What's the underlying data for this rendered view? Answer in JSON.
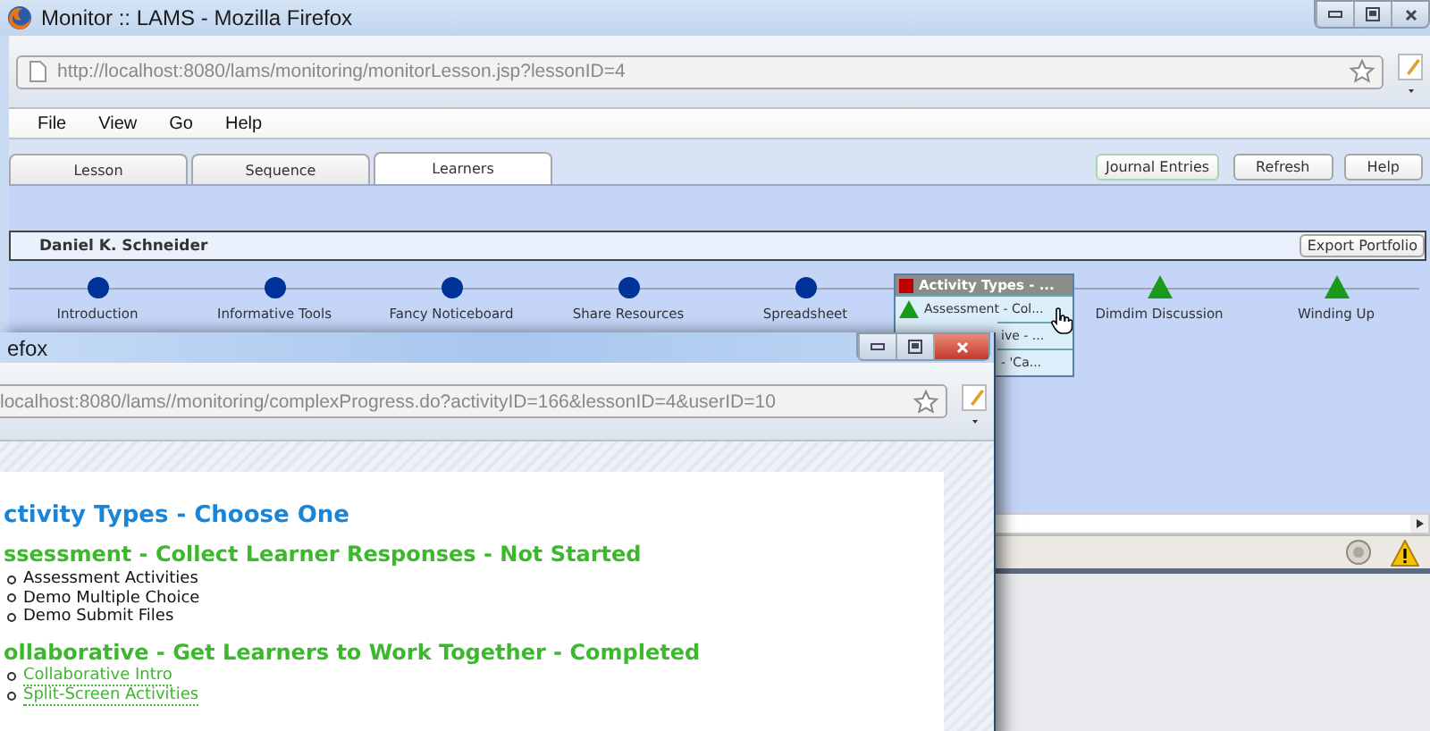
{
  "main_window": {
    "title": "Monitor :: LAMS - Mozilla Firefox",
    "url": "http://localhost:8080/lams/monitoring/monitorLesson.jsp?lessonID=4",
    "menu": [
      "File",
      "View",
      "Go",
      "Help"
    ],
    "tabs": [
      {
        "label": "Lesson",
        "selected": false
      },
      {
        "label": "Sequence",
        "selected": false
      },
      {
        "label": "Learners",
        "selected": true
      }
    ],
    "buttons": [
      "Journal Entries",
      "Refresh",
      "Help"
    ],
    "learner": {
      "name": "Daniel K. Schneider",
      "export_button": "Export Portfolio"
    },
    "activities": [
      {
        "label": "Introduction",
        "kind": "circle"
      },
      {
        "label": "Informative Tools",
        "kind": "circle"
      },
      {
        "label": "Fancy Noticeboard",
        "kind": "circle"
      },
      {
        "label": "Share Resources",
        "kind": "circle"
      },
      {
        "label": "Spreadsheet",
        "kind": "circle"
      },
      {
        "kind": "popup"
      },
      {
        "label": "Dimdim Discussion",
        "kind": "triangle"
      },
      {
        "label": "Winding Up",
        "kind": "triangle"
      }
    ],
    "popup": {
      "title": "Activity Types - ...",
      "rows": [
        {
          "label": "Assessment - Col...",
          "kind": "triangle"
        },
        {
          "label": "ive - ...",
          "kind": "hidden"
        },
        {
          "label": "- 'Ca...",
          "kind": "hidden"
        }
      ]
    }
  },
  "popup_window": {
    "title": "efox",
    "url": "localhost:8080/lams//monitoring/complexProgress.do?activityID=166&lessonID=4&userID=10",
    "title_heading": "ctivity Types - Choose One",
    "sections": [
      {
        "heading": "ssessment - Collect Learner Responses - Not Started",
        "items": [
          {
            "label": "Assessment Activities",
            "kind": "plain"
          },
          {
            "label": "Demo Multiple Choice",
            "kind": "plain"
          },
          {
            "label": "Demo Submit Files",
            "kind": "plain"
          }
        ]
      },
      {
        "heading": "ollaborative - Get Learners to Work Together - Completed",
        "items": [
          {
            "label": "Collaborative Intro",
            "kind": "link"
          },
          {
            "label": "Split-Screen Activities",
            "kind": "link"
          }
        ]
      }
    ]
  }
}
